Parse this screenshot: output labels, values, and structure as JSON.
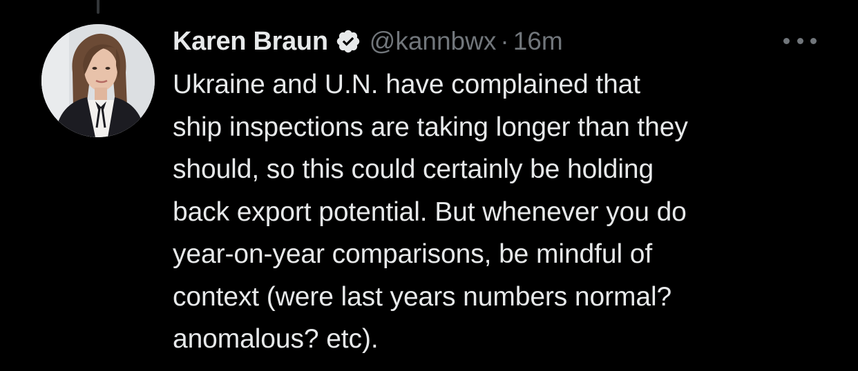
{
  "tweet": {
    "author": {
      "display_name": "Karen Braun",
      "handle": "@kannbwx",
      "verified": true,
      "avatar_icon": "profile-photo"
    },
    "separator": "·",
    "timestamp": "16m",
    "text": "Ukraine and U.N. have complained that\nship inspections are taking longer than they\nshould, so this could certainly be holding\nback export potential. But whenever you do\nyear-on-year comparisons, be mindful of\ncontext (were last years numbers normal?\nanomalous? etc).",
    "more_icon": "more-options-icon"
  },
  "colors": {
    "background": "#000000",
    "primary_text": "#e7e9ea",
    "secondary_text": "#71767b",
    "verified_badge": "#e7e9ea"
  }
}
